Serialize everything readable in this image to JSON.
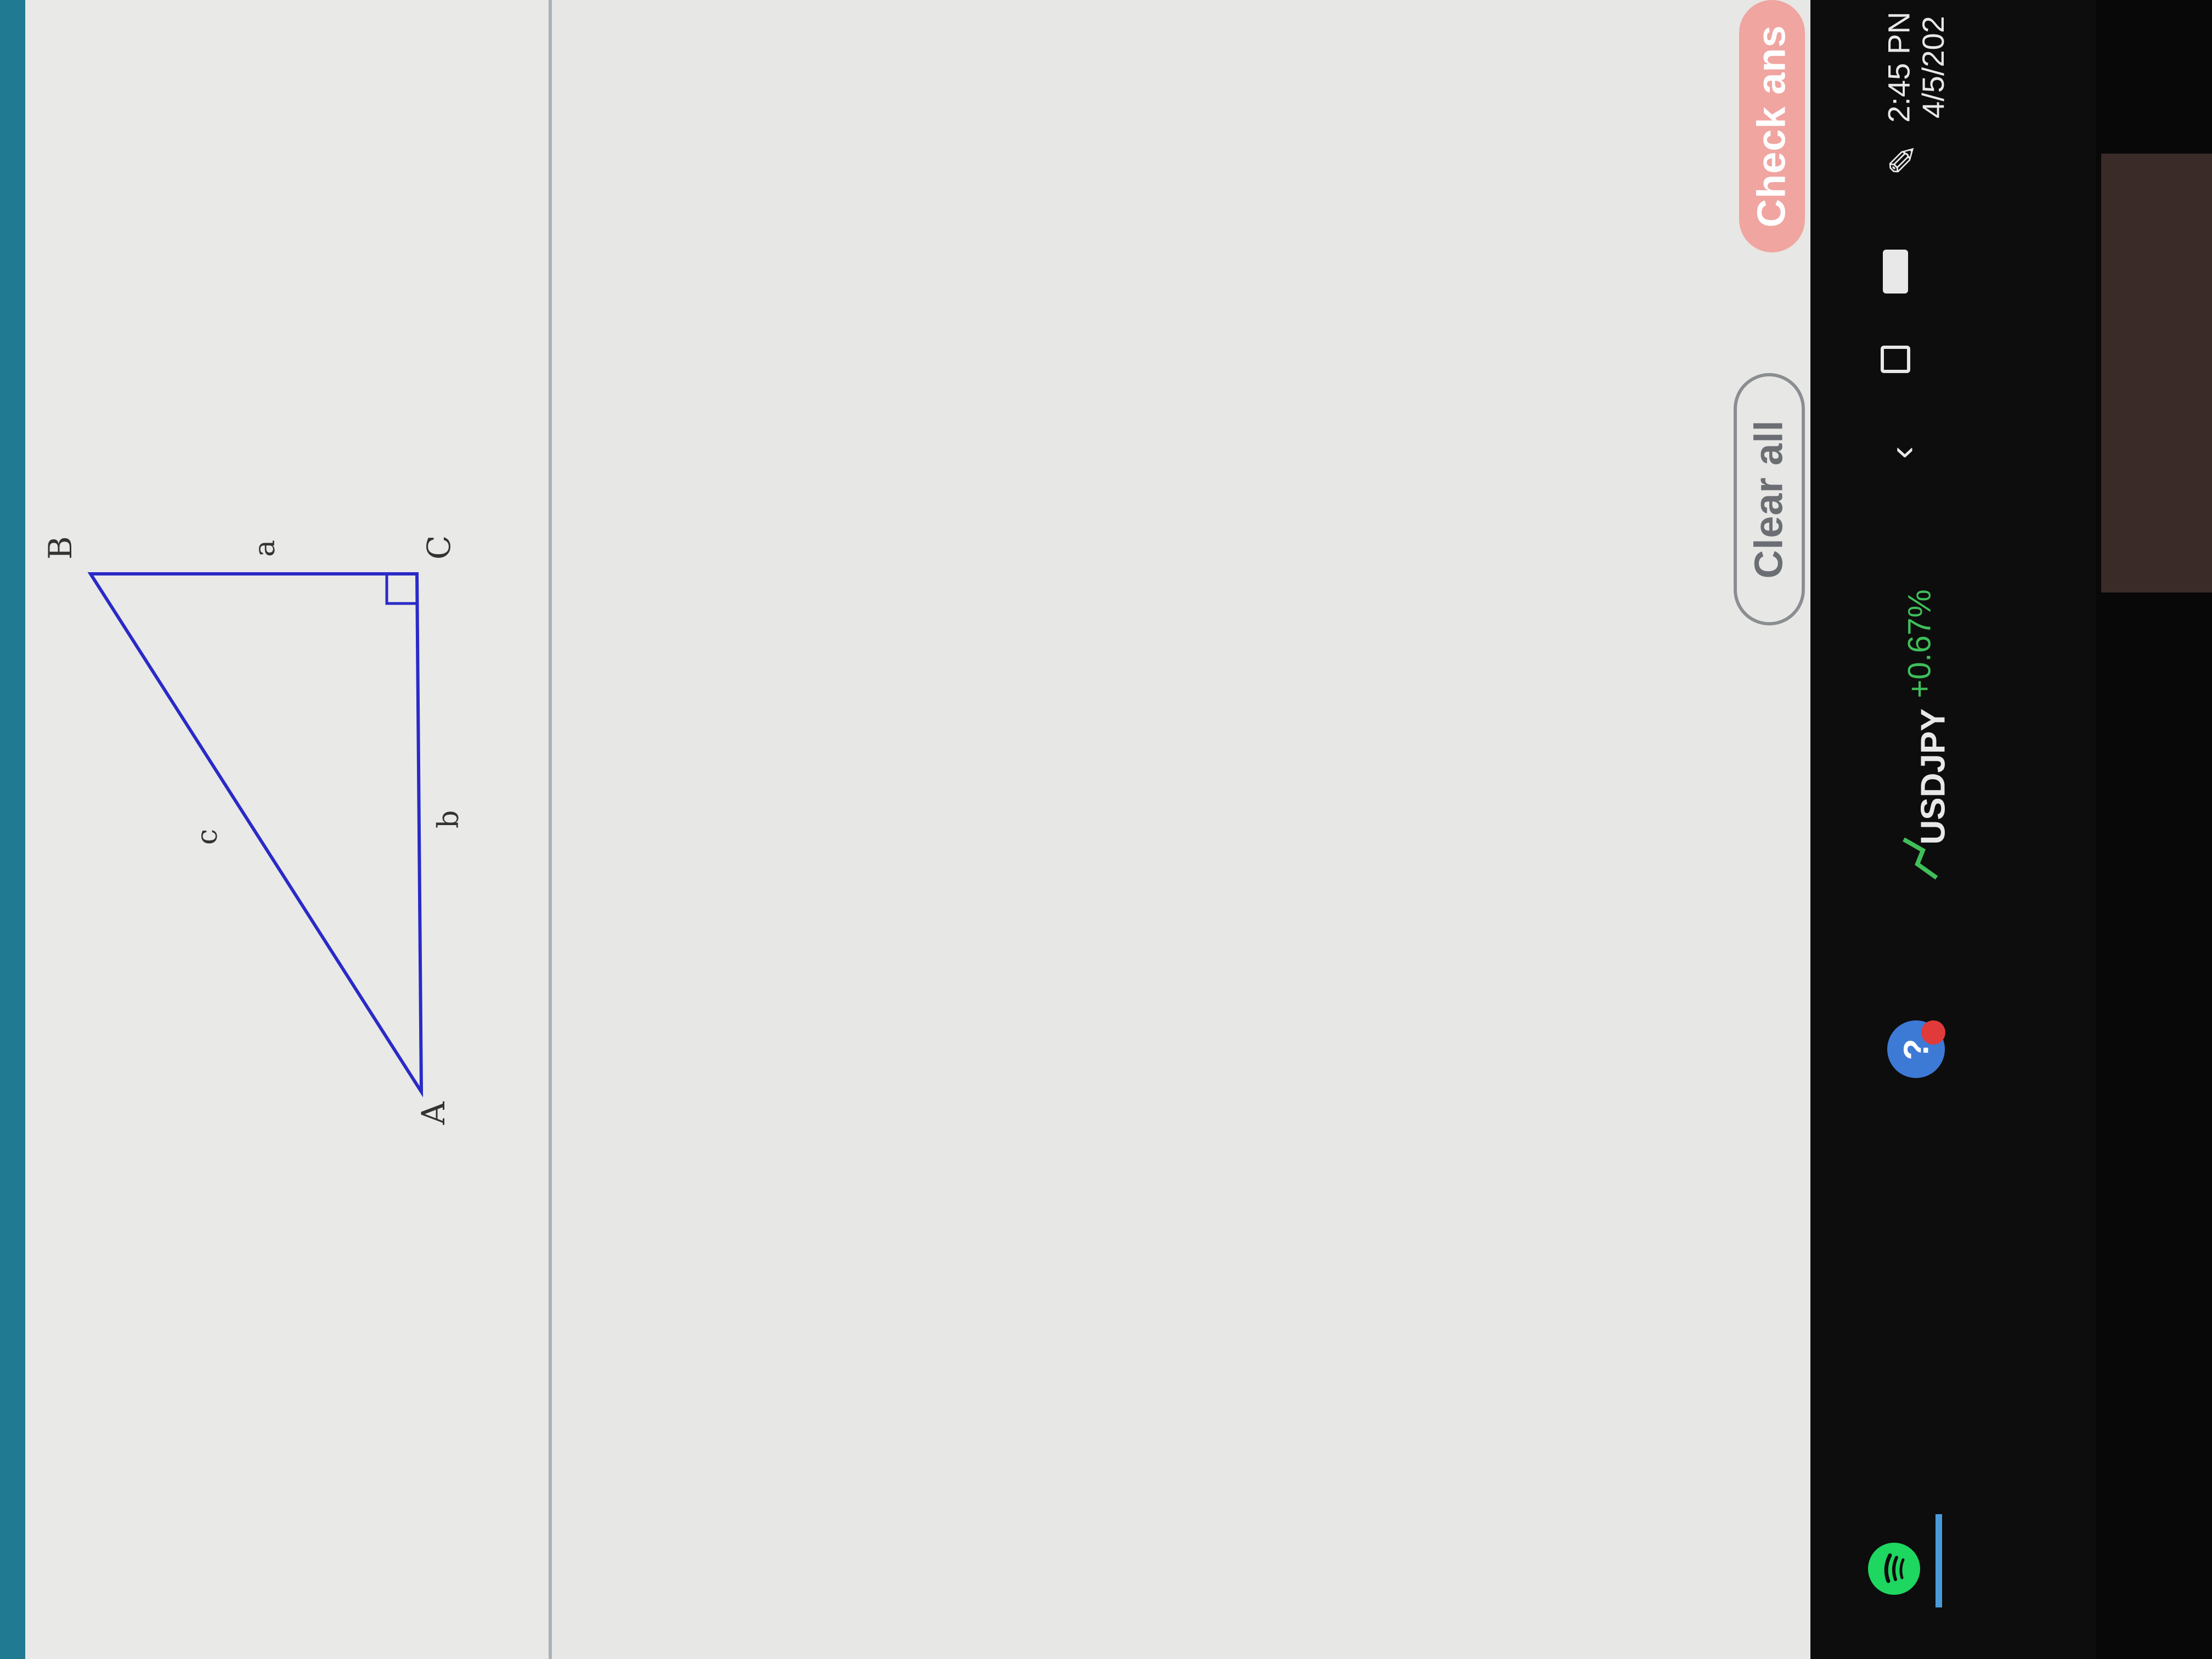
{
  "diagram": {
    "vertices": {
      "A": "A",
      "B": "B",
      "C": "C"
    },
    "sides": {
      "a": "a",
      "b": "b",
      "c": "c"
    }
  },
  "buttons": {
    "check_answer": "Check ans",
    "clear_all": "Clear all"
  },
  "taskbar": {
    "ticker_symbol": "USDJPY",
    "ticker_change": "+0.67%",
    "time": "2:45 PN",
    "date": "4/5/202"
  },
  "colors": {
    "triangle_stroke": "#2a2ac8",
    "check_button": "#f0a5a0",
    "ticker_positive": "#3fbf5a",
    "spotify": "#1ed760"
  }
}
